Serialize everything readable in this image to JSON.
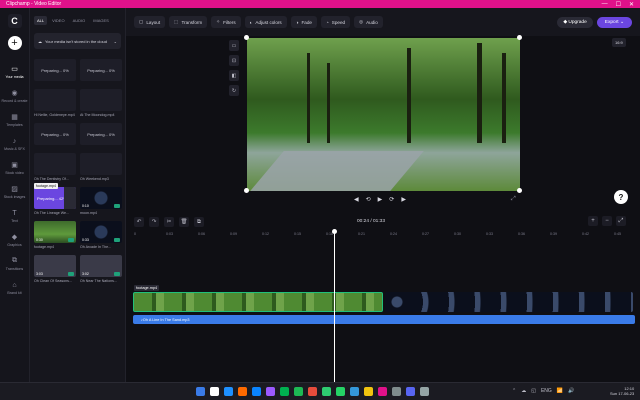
{
  "window": {
    "title": "Clipchamp - Video Editor",
    "controls": [
      "—",
      "☐",
      "✕"
    ]
  },
  "rail": {
    "items": [
      {
        "label": "Your media",
        "icon": "folder-icon",
        "glyph": "▭",
        "active": true
      },
      {
        "label": "Record & create",
        "icon": "record-icon",
        "glyph": "◉"
      },
      {
        "label": "Templates",
        "icon": "templates-icon",
        "glyph": "▦"
      },
      {
        "label": "Music & SFX",
        "icon": "music-icon",
        "glyph": "♪"
      },
      {
        "label": "Stock video",
        "icon": "video-icon",
        "glyph": "▣"
      },
      {
        "label": "Stock images",
        "icon": "image-icon",
        "glyph": "▨"
      },
      {
        "label": "Text",
        "icon": "text-icon",
        "glyph": "T"
      },
      {
        "label": "Graphics",
        "icon": "graphics-icon",
        "glyph": "◆"
      },
      {
        "label": "Transitions",
        "icon": "transitions-icon",
        "glyph": "⧉"
      },
      {
        "label": "Brand kit",
        "icon": "brand-icon",
        "glyph": "⌂"
      }
    ]
  },
  "media": {
    "tabs": [
      "ALL",
      "VIDEO",
      "AUDIO",
      "IMAGES"
    ],
    "active_tab": "ALL",
    "cloud_notice": "Your media isn't stored in the cloud",
    "cards": [
      {
        "thumb": "Preparing... 0%",
        "name": "",
        "style": "plain"
      },
      {
        "thumb": "Preparing... 0%",
        "name": "",
        "style": "plain"
      },
      {
        "thumb": "",
        "name": "Hi Nellie, Goldeneye.mp4",
        "style": "plain"
      },
      {
        "thumb": "",
        "name": "At The Moondog.mp4",
        "style": "plain"
      },
      {
        "thumb": "Preparing... 0%",
        "name": "",
        "style": "plain"
      },
      {
        "thumb": "Preparing... 0%",
        "name": "",
        "style": "plain"
      },
      {
        "thumb": "",
        "name": "Oh The Dentistry Of...",
        "style": "plain"
      },
      {
        "thumb": "",
        "name": "Oh Weekend.mp3",
        "style": "plain"
      },
      {
        "thumb": "Preparing... 42%",
        "name": "Oh The Lineage We...",
        "style": "purple"
      },
      {
        "thumb": "",
        "name": "moon.mp4",
        "style": "moon",
        "dur": "0:10"
      },
      {
        "thumb": "",
        "name": "footage.mp4",
        "style": "forest",
        "dur": "0:30"
      },
      {
        "thumb": "",
        "name": "Oh Arcade In The...",
        "style": "moon",
        "dur": "0:33"
      },
      {
        "thumb": "",
        "name": "Oh Clean Of Seasons...",
        "style": "grey",
        "dur": "3:03"
      },
      {
        "thumb": "",
        "name": "Oh Near The Nations...",
        "style": "grey",
        "dur": "3:02"
      }
    ],
    "tooltip": "footage.mp4"
  },
  "toolbar": {
    "buttons": [
      {
        "label": "Layout",
        "icon": "layout-icon",
        "glyph": "▢"
      },
      {
        "label": "Transform",
        "icon": "transform-icon",
        "glyph": "⬚"
      },
      {
        "label": "Filters",
        "icon": "filters-icon",
        "glyph": "✧"
      },
      {
        "label": "Adjust colors",
        "icon": "adjust-colors-icon",
        "glyph": "◐"
      },
      {
        "label": "Fade",
        "icon": "fade-icon",
        "glyph": "◑"
      },
      {
        "label": "Speed",
        "icon": "speed-icon",
        "glyph": "◔"
      },
      {
        "label": "Audio",
        "icon": "audio-icon",
        "glyph": "◎"
      }
    ],
    "upgrade": "Upgrade",
    "export": "Export"
  },
  "preview": {
    "aspect": "16:9",
    "play_controls": [
      {
        "glyph": "◀",
        "icon": "skip-back-icon"
      },
      {
        "glyph": "⟲",
        "icon": "rewind-icon"
      },
      {
        "glyph": "▶",
        "icon": "play-icon"
      },
      {
        "glyph": "⟳",
        "icon": "forward-icon"
      },
      {
        "glyph": "▶",
        "icon": "skip-forward-icon"
      }
    ],
    "fullscreen_glyph": "⤢",
    "help_glyph": "?"
  },
  "timeline": {
    "time_current": "00:24",
    "time_total": "01:33",
    "ticks": [
      "0",
      "0:03",
      "0:06",
      "0:09",
      "0:12",
      "0:15",
      "0:18",
      "0:21",
      "0:24",
      "0:27",
      "0:30",
      "0:33",
      "0:36",
      "0:39",
      "0:42",
      "0:45"
    ],
    "controls": [
      {
        "glyph": "↶",
        "icon": "undo-icon"
      },
      {
        "glyph": "↷",
        "icon": "redo-icon"
      },
      {
        "glyph": "✂",
        "icon": "split-icon"
      },
      {
        "glyph": "🗑",
        "icon": "delete-icon"
      },
      {
        "glyph": "⧉",
        "icon": "duplicate-icon"
      }
    ],
    "zoom": {
      "in": "+",
      "out": "−",
      "fit": "⤢"
    },
    "video_track_label": "footage.mp4",
    "audio_clip_label": "Oh A Line In The Sand.mp3",
    "playhead_fraction": 0.4
  },
  "taskbar": {
    "apps": [
      "#3a7be8",
      "#fff",
      "#1e90ff",
      "#ff6a00",
      "#0a84ff",
      "#9b59ff",
      "#00b050",
      "#1db954",
      "#e74c3c",
      "#2ecc71",
      "#25d366",
      "#3498db",
      "#f1c40f",
      "#e0118a",
      "#7f8c8d",
      "#5865f2",
      "#95a5a6"
    ],
    "tray": [
      "⌃",
      "☁",
      "◱",
      "ENG",
      "📶",
      "🔊"
    ],
    "time": "12:10",
    "date": "Sun 17-06-23"
  }
}
